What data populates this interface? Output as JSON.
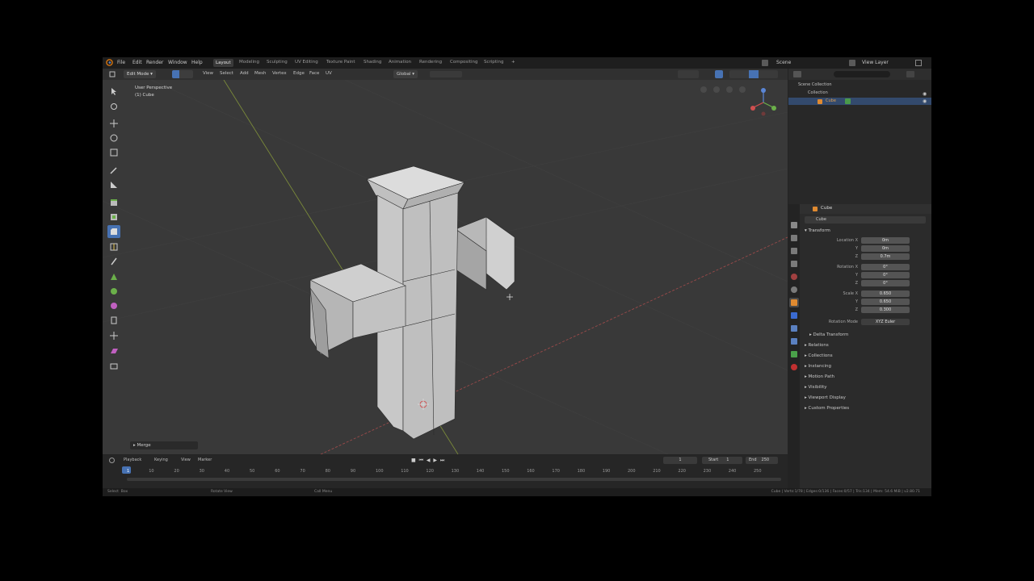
{
  "topbar": {
    "menus": [
      "File",
      "Edit",
      "Render",
      "Window",
      "Help"
    ],
    "workspaces": [
      "Layout",
      "Modeling",
      "Sculpting",
      "UV Editing",
      "Texture Paint",
      "Shading",
      "Animation",
      "Rendering",
      "Compositing",
      "Scripting"
    ],
    "active_workspace": "Layout",
    "scene_label": "Scene",
    "view_layer_label": "View Layer"
  },
  "viewport_header": {
    "mode": "Edit Mode",
    "menus": [
      "View",
      "Select",
      "Add",
      "Mesh",
      "Vertex",
      "Edge",
      "Face",
      "UV"
    ],
    "transform_orientation": "Global"
  },
  "viewport_info": {
    "line1": "User Perspective",
    "line2": "(1) Cube"
  },
  "operator_panel": {
    "label": "Merge"
  },
  "outliner": {
    "scene_collection": "Scene Collection",
    "collection": "Collection",
    "object": "Cube"
  },
  "properties": {
    "object_name": "Cube",
    "sub_name": "Cube",
    "transform_header": "Transform",
    "location_label": "Location X",
    "location": [
      "0m",
      "0m",
      "0.7m"
    ],
    "rotation_label": "Rotation X",
    "rotation": [
      "0°",
      "0°",
      "0°"
    ],
    "scale_label": "Scale X",
    "scale": [
      "0.650",
      "0.650",
      "0.300"
    ],
    "y_label": "Y",
    "z_label": "Z",
    "rotation_mode_label": "Rotation Mode",
    "rotation_mode": "XYZ Euler",
    "delta_transform": "Delta Transform",
    "panels": [
      "Relations",
      "Collections",
      "Instancing",
      "Motion Path",
      "Visibility",
      "Viewport Display",
      "Custom Properties"
    ]
  },
  "timeline": {
    "menus": [
      "Playback",
      "Keying",
      "View",
      "Marker"
    ],
    "current_frame": "1",
    "start_label": "Start",
    "start": "1",
    "end_label": "End",
    "end": "250",
    "ticks": [
      "1",
      "10",
      "20",
      "30",
      "40",
      "50",
      "60",
      "70",
      "80",
      "90",
      "100",
      "110",
      "120",
      "130",
      "140",
      "150",
      "160",
      "170",
      "180",
      "190",
      "200",
      "210",
      "220",
      "230",
      "240",
      "250"
    ]
  },
  "status": {
    "left": "Select",
    "left2": "Box",
    "middle": "Rotate View",
    "middle2": "Call Menu",
    "right": "Cube | Verts:1/78 | Edges:0/136 | Faces:0/57 | Tris:134 | Mem: 54.6 MiB | v2.80.71"
  },
  "colors": {
    "accent": "#4772b3",
    "viewport_bg": "#393939",
    "panel_bg": "#2b2b2b"
  }
}
